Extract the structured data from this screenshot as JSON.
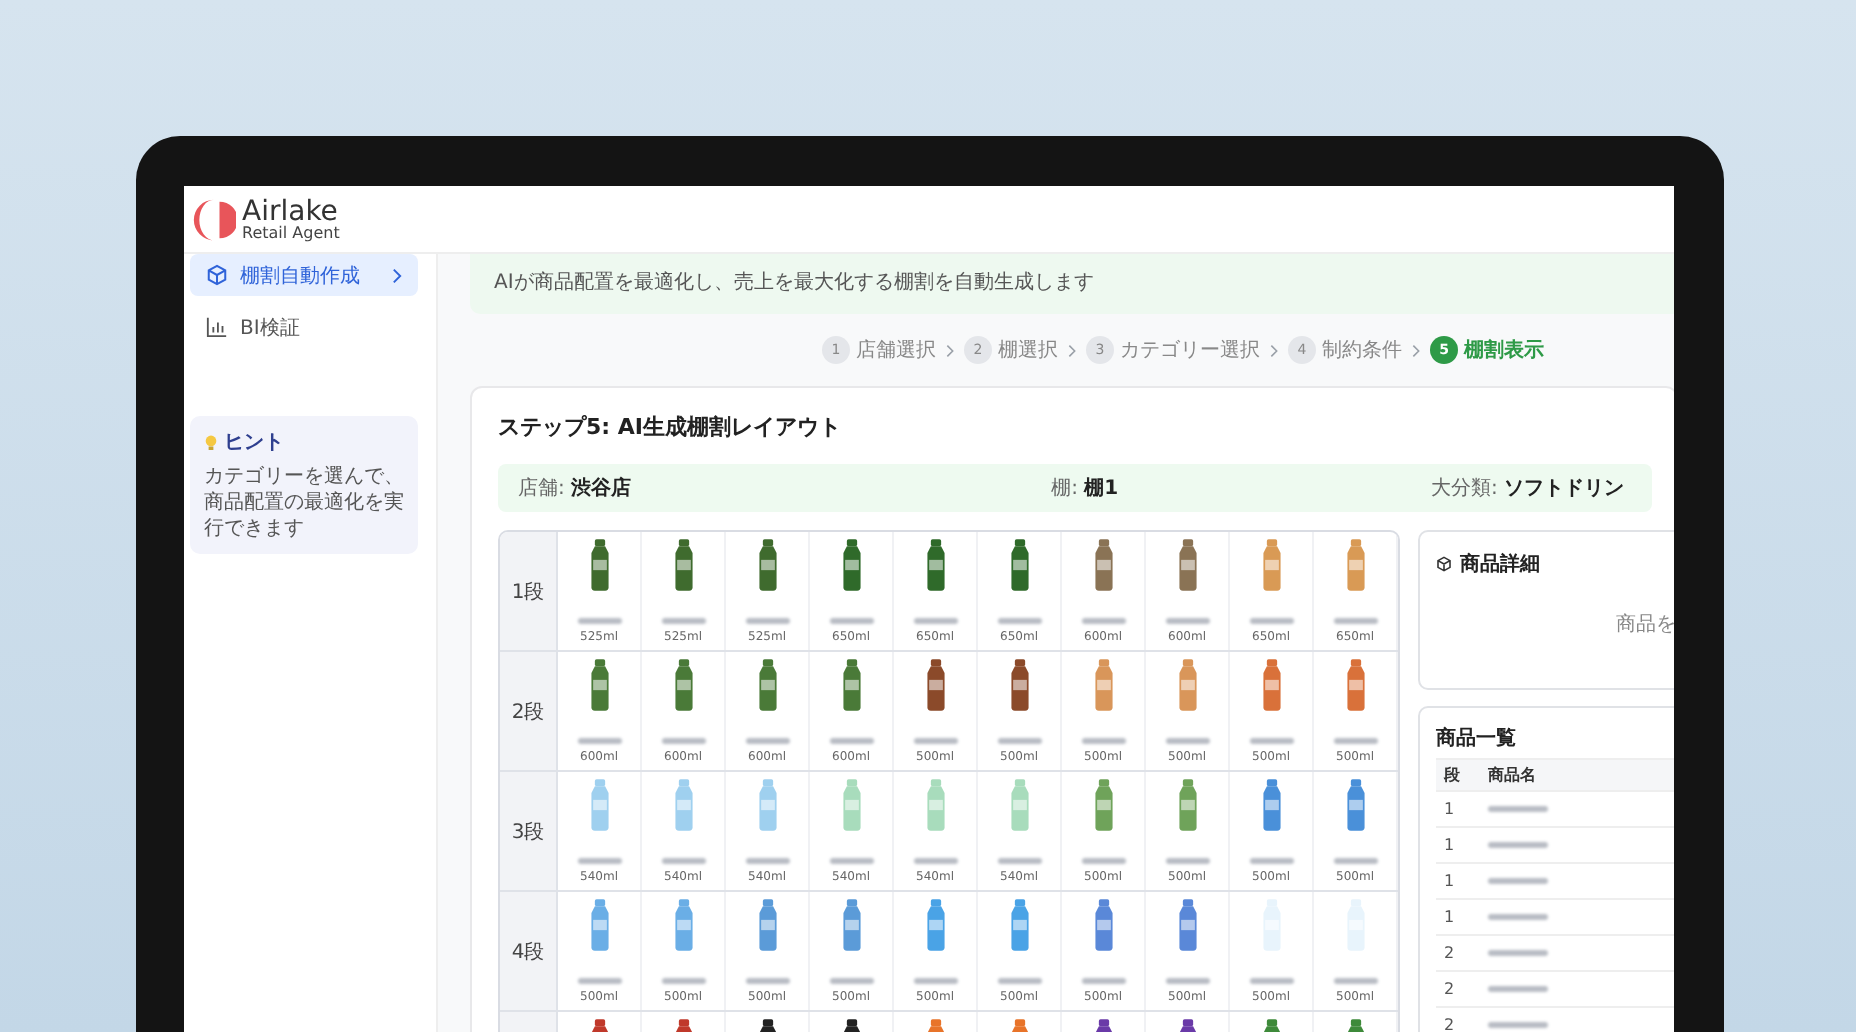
{
  "logo": {
    "name": "Airlake",
    "tagline": "Retail Agent"
  },
  "sidebar": {
    "items": [
      {
        "label": "棚割自動作成",
        "selected": true
      },
      {
        "label": "BI検証",
        "selected": false
      }
    ],
    "hint": {
      "title": "ヒント",
      "text": "カテゴリーを選んで、商品配置の最適化を実行できます"
    }
  },
  "banner": "AIが商品配置を最適化し、売上を最大化する棚割を自動生成します",
  "steps": [
    {
      "number": "1",
      "label": "店舗選択",
      "selected": false
    },
    {
      "number": "2",
      "label": "棚選択",
      "selected": false
    },
    {
      "number": "3",
      "label": "カテゴリー選択",
      "selected": false
    },
    {
      "number": "4",
      "label": "制約条件",
      "selected": false
    },
    {
      "number": "5",
      "label": "棚割表示",
      "selected": true
    }
  ],
  "card": {
    "title": "ステップ5: AI生成棚割レイアウト",
    "info": [
      {
        "label": "店舗:",
        "value": "渋谷店"
      },
      {
        "label": "棚:",
        "value": "棚1"
      },
      {
        "label": "大分類:",
        "value": "ソフトドリン"
      }
    ],
    "shelves": [
      {
        "label": "1段",
        "items": [
          {
            "color": "#3f6b2e",
            "volume": "525ml"
          },
          {
            "color": "#3f6b2e",
            "volume": "525ml"
          },
          {
            "color": "#3f6b2e",
            "volume": "525ml"
          },
          {
            "color": "#2f6a2a",
            "volume": "650ml"
          },
          {
            "color": "#2f6a2a",
            "volume": "650ml"
          },
          {
            "color": "#2f6a2a",
            "volume": "650ml"
          },
          {
            "color": "#8a7355",
            "volume": "600ml"
          },
          {
            "color": "#8a7355",
            "volume": "600ml"
          },
          {
            "color": "#d99a55",
            "volume": "650ml"
          },
          {
            "color": "#d99a55",
            "volume": "650ml"
          }
        ]
      },
      {
        "label": "2段",
        "items": [
          {
            "color": "#4a7a38",
            "volume": "600ml"
          },
          {
            "color": "#4a7a38",
            "volume": "600ml"
          },
          {
            "color": "#4a7a38",
            "volume": "600ml"
          },
          {
            "color": "#4a7a38",
            "volume": "600ml"
          },
          {
            "color": "#8b4a2a",
            "volume": "500ml"
          },
          {
            "color": "#8b4a2a",
            "volume": "500ml"
          },
          {
            "color": "#d9965a",
            "volume": "500ml"
          },
          {
            "color": "#d9965a",
            "volume": "500ml"
          },
          {
            "color": "#d9713a",
            "volume": "500ml"
          },
          {
            "color": "#d9713a",
            "volume": "500ml"
          }
        ]
      },
      {
        "label": "3段",
        "items": [
          {
            "color": "#9fd0ef",
            "volume": "540ml"
          },
          {
            "color": "#9fd0ef",
            "volume": "540ml"
          },
          {
            "color": "#9fd0ef",
            "volume": "540ml"
          },
          {
            "color": "#a8dcbc",
            "volume": "540ml"
          },
          {
            "color": "#a8dcbc",
            "volume": "540ml"
          },
          {
            "color": "#a8dcbc",
            "volume": "540ml"
          },
          {
            "color": "#6fa35a",
            "volume": "500ml"
          },
          {
            "color": "#6fa35a",
            "volume": "500ml"
          },
          {
            "color": "#4a90d9",
            "volume": "500ml"
          },
          {
            "color": "#4a90d9",
            "volume": "500ml"
          }
        ]
      },
      {
        "label": "4段",
        "items": [
          {
            "color": "#6aaee6",
            "volume": "500ml"
          },
          {
            "color": "#6aaee6",
            "volume": "500ml"
          },
          {
            "color": "#5b9bd8",
            "volume": "500ml"
          },
          {
            "color": "#5b9bd8",
            "volume": "500ml"
          },
          {
            "color": "#4aa3e6",
            "volume": "500ml"
          },
          {
            "color": "#4aa3e6",
            "volume": "500ml"
          },
          {
            "color": "#5a88d8",
            "volume": "500ml"
          },
          {
            "color": "#5a88d8",
            "volume": "500ml"
          },
          {
            "color": "#e8f4fc",
            "volume": "500ml"
          },
          {
            "color": "#e8f4fc",
            "volume": "500ml"
          }
        ]
      },
      {
        "items": [
          {
            "color": "#c0392b"
          },
          {
            "color": "#c0392b"
          },
          {
            "color": "#222222"
          },
          {
            "color": "#222222"
          },
          {
            "color": "#e8742a"
          },
          {
            "color": "#e8742a"
          },
          {
            "color": "#6a3aa8"
          },
          {
            "color": "#6a3aa8"
          },
          {
            "color": "#3e8a3a"
          },
          {
            "color": "#3e8a3a"
          }
        ]
      }
    ]
  },
  "detail": {
    "title": "商品詳細",
    "message": "商品を"
  },
  "product_list": {
    "title": "商品一覧",
    "columns": [
      "段",
      "商品名"
    ],
    "rows": [
      {
        "shelf": "1"
      },
      {
        "shelf": "1"
      },
      {
        "shelf": "1"
      },
      {
        "shelf": "1"
      },
      {
        "shelf": "2"
      },
      {
        "shelf": "2"
      },
      {
        "shelf": "2"
      }
    ]
  }
}
